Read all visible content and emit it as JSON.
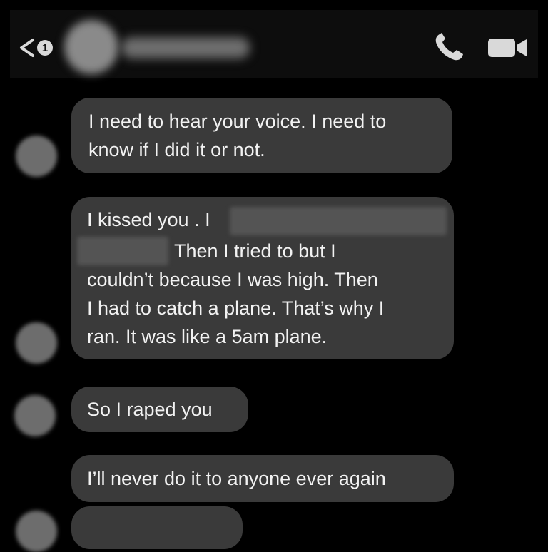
{
  "header": {
    "unread_count": "1",
    "icons": {
      "back": "chevron-left-icon",
      "call": "phone-icon",
      "video": "video-camera-icon"
    }
  },
  "messages": [
    {
      "text": "I need to hear your voice. I need to\nknow if I did it or not."
    },
    {
      "line1_prefix": "I kissed you . I",
      "line2_suffix": "Then I tried to but I",
      "rest": "couldn’t because I was high. Then\nI had to catch a plane. That’s why I\nran.  It was like a 5am plane."
    },
    {
      "text": "So I raped you"
    },
    {
      "text": "I’ll never do it to anyone ever again"
    }
  ],
  "colors": {
    "background": "#000000",
    "bubble": "#3a3a3a",
    "text": "#f2f2f2"
  }
}
